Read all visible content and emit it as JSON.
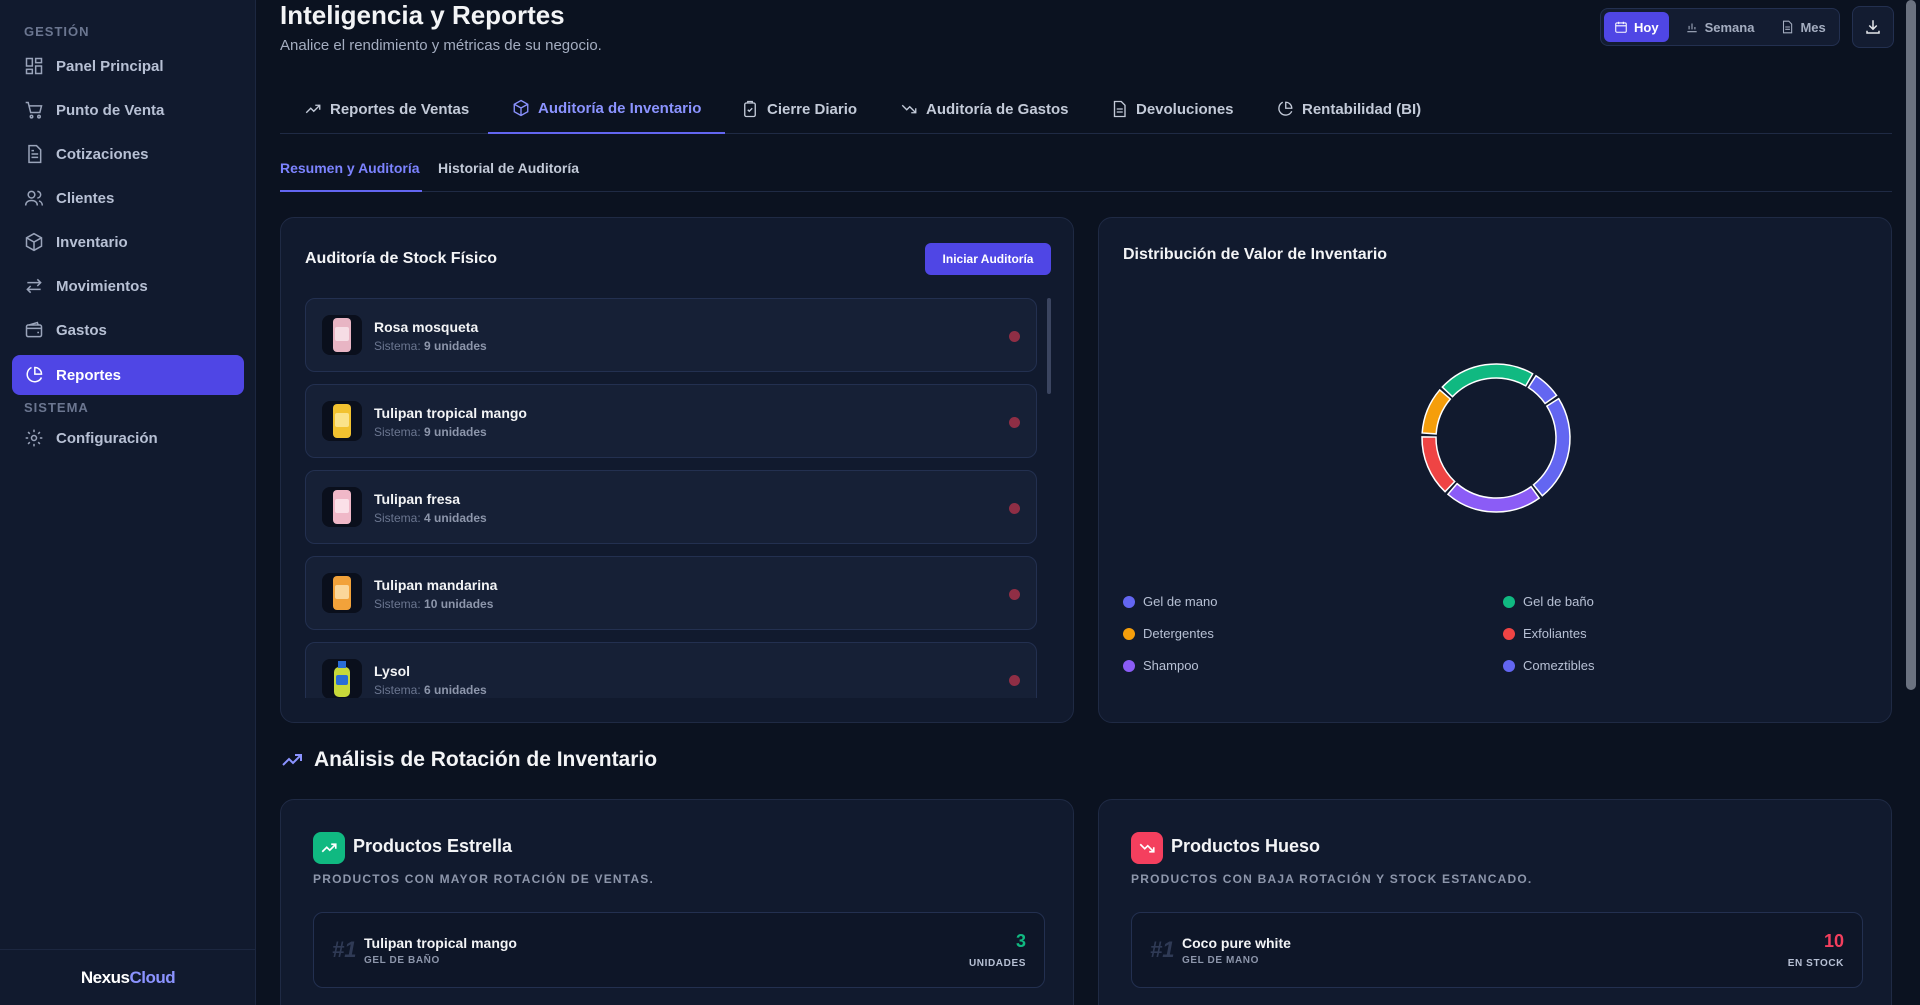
{
  "sidebar": {
    "section_gestion": "GESTIÓN",
    "section_sistema": "SISTEMA",
    "items": [
      {
        "label": "Panel Principal",
        "icon": "dashboard-icon"
      },
      {
        "label": "Punto de Venta",
        "icon": "cart-icon"
      },
      {
        "label": "Cotizaciones",
        "icon": "document-icon"
      },
      {
        "label": "Clientes",
        "icon": "users-icon"
      },
      {
        "label": "Inventario",
        "icon": "box-icon"
      },
      {
        "label": "Movimientos",
        "icon": "arrows-icon"
      },
      {
        "label": "Gastos",
        "icon": "wallet-icon"
      },
      {
        "label": "Reportes",
        "icon": "pie-chart-icon",
        "active": true
      }
    ],
    "settings_label": "Configuración",
    "brand_part1": "Nexus",
    "brand_part2": "Cloud"
  },
  "header": {
    "title": "Inteligencia y Reportes",
    "subtitle": "Analice el rendimiento y métricas de su negocio.",
    "ranges": [
      "Hoy",
      "Semana",
      "Mes"
    ],
    "active_range": "Hoy"
  },
  "tabs": [
    {
      "label": "Reportes de Ventas",
      "icon": "trending-up-icon"
    },
    {
      "label": "Auditoría de Inventario",
      "icon": "box-icon",
      "active": true
    },
    {
      "label": "Cierre Diario",
      "icon": "clipboard-icon"
    },
    {
      "label": "Auditoría de Gastos",
      "icon": "trending-down-icon"
    },
    {
      "label": "Devoluciones",
      "icon": "document-icon"
    },
    {
      "label": "Rentabilidad (BI)",
      "icon": "pie-chart-icon"
    }
  ],
  "subtabs": [
    {
      "label": "Resumen y Auditoría",
      "active": true
    },
    {
      "label": "Historial de Auditoría"
    }
  ],
  "stock_audit": {
    "title": "Auditoría de Stock Físico",
    "button": "Iniciar Auditoría",
    "system_label": "Sistema:",
    "items": [
      {
        "name": "Rosa mosqueta",
        "units": "9 unidades",
        "thumb_color": "#e8b5c4"
      },
      {
        "name": "Tulipan tropical mango",
        "units": "9 unidades",
        "thumb_color": "#f2c230"
      },
      {
        "name": "Tulipan fresa",
        "units": "4 unidades",
        "thumb_color": "#f0b8c8"
      },
      {
        "name": "Tulipan mandarina",
        "units": "10 unidades",
        "thumb_color": "#f2a23a"
      },
      {
        "name": "Lysol",
        "units": "6 unidades",
        "thumb_color": "#c8d93a"
      }
    ]
  },
  "distribution": {
    "title": "Distribución de Valor de Inventario",
    "legend": [
      {
        "label": "Gel de mano",
        "color": "#6366f1"
      },
      {
        "label": "Gel de baño",
        "color": "#10b981"
      },
      {
        "label": "Detergentes",
        "color": "#f59e0b"
      },
      {
        "label": "Exfoliantes",
        "color": "#ef4444"
      },
      {
        "label": "Shampoo",
        "color": "#8b5cf6"
      },
      {
        "label": "Comeztibles",
        "color": "#6366f1"
      }
    ]
  },
  "chart_data": {
    "type": "pie",
    "categories": [
      "Gel de baño",
      "Gel de mano",
      "Comeztibles",
      "Shampoo",
      "Exfoliantes",
      "Detergentes"
    ],
    "values": [
      22,
      7,
      24,
      22,
      14,
      11
    ],
    "colors": [
      "#10b981",
      "#6366f1",
      "#6366f1",
      "#8b5cf6",
      "#ef4444",
      "#f59e0b"
    ],
    "title": "Distribución de Valor de Inventario",
    "legend_position": "bottom"
  },
  "rotation": {
    "title": "Análisis de Rotación de Inventario",
    "star": {
      "title": "Productos Estrella",
      "subtitle": "PRODUCTOS CON MAYOR ROTACIÓN DE VENTAS.",
      "rank": "#1",
      "name": "Tulipan tropical mango",
      "category": "GEL DE BAÑO",
      "value": "3",
      "unit": "UNIDADES",
      "color": "#10b981"
    },
    "bone": {
      "title": "Productos Hueso",
      "subtitle": "PRODUCTOS CON BAJA ROTACIÓN Y STOCK ESTANCADO.",
      "rank": "#1",
      "name": "Coco pure white",
      "category": "GEL DE MANO",
      "value": "10",
      "unit": "EN STOCK",
      "color": "#f43f5e"
    }
  }
}
